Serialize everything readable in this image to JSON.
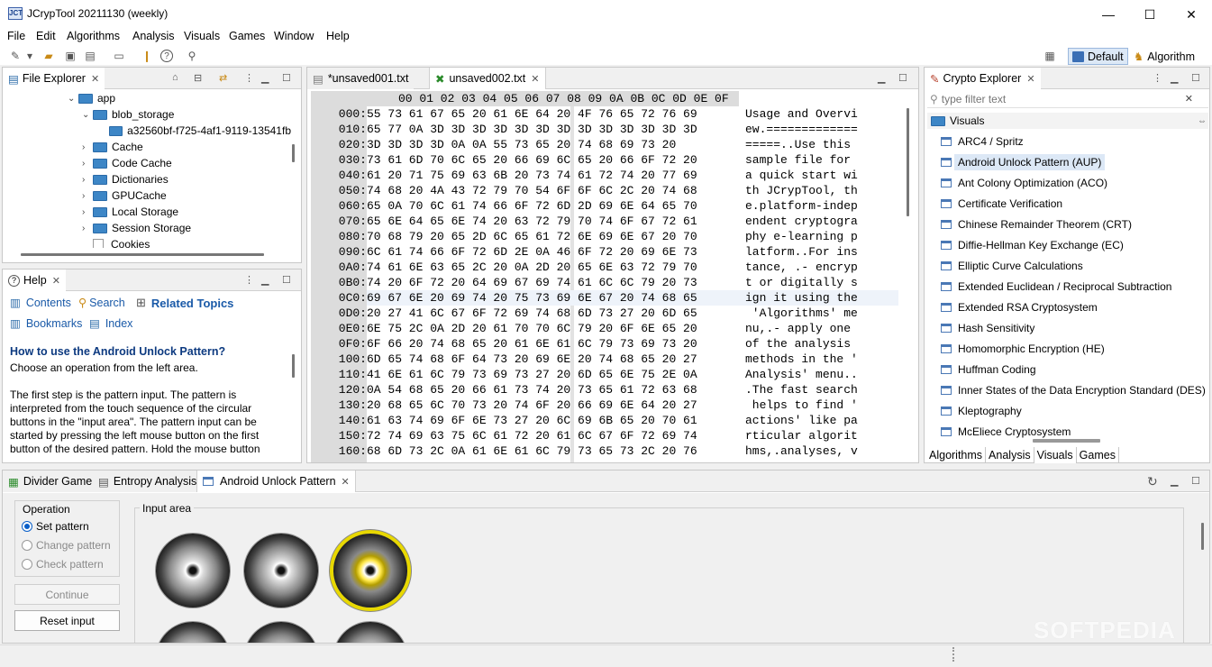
{
  "window": {
    "title": "JCrypTool 20211130 (weekly)",
    "icon": "JCT",
    "minimize": "—",
    "maximize": "☐",
    "close": "✕"
  },
  "menu": [
    "File",
    "Edit",
    "Algorithms",
    "Analysis",
    "Visuals",
    "Games",
    "Window",
    "Help"
  ],
  "perspectives": {
    "default": "Default",
    "algorithm": "Algorithm"
  },
  "file_explorer": {
    "tab": "File Explorer",
    "tree": [
      {
        "label": "app",
        "expanded": true
      },
      {
        "label": "blob_storage",
        "expanded": true
      },
      {
        "label": "a32560bf-f725-4af1-9119-13541fb"
      },
      {
        "label": "Cache"
      },
      {
        "label": "Code Cache"
      },
      {
        "label": "Dictionaries"
      },
      {
        "label": "GPUCache"
      },
      {
        "label": "Local Storage"
      },
      {
        "label": "Session Storage"
      },
      {
        "label": "Cookies"
      }
    ]
  },
  "help": {
    "tab": "Help",
    "contents": "Contents",
    "search": "Search",
    "related": "Related Topics",
    "bookmarks": "Bookmarks",
    "index": "Index",
    "heading": "How to use the Android Unlock Pattern?",
    "intro": "Choose an operation from the left area.",
    "body1": "The first step is the pattern input. The pattern is",
    "body2": "interpreted from the touch sequence of the circular",
    "body3": "buttons in the \"input area\". The pattern input can be",
    "body4": "started by pressing the left mouse button on the first",
    "body5": "button of the desired pattern. Hold the mouse button"
  },
  "editor": {
    "tabs": [
      "*unsaved001.txt",
      "unsaved002.txt"
    ],
    "header": "00 01 02 03 04 05 06 07 08 09 0A 0B 0C 0D 0E 0F",
    "rows": [
      {
        "off": "000:",
        "hex": "55 73 61 67 65 20 61 6E 64 20 4F 76 65 72 76 69",
        "txt": "Usage and Overvi"
      },
      {
        "off": "010:",
        "hex": "65 77 0A 3D 3D 3D 3D 3D 3D 3D 3D 3D 3D 3D 3D 3D",
        "txt": "ew.============="
      },
      {
        "off": "020:",
        "hex": "3D 3D 3D 3D 0A 0A 55 73 65 20 74 68 69 73 20",
        "txt": "=====..Use this "
      },
      {
        "off": "030:",
        "hex": "73 61 6D 70 6C 65 20 66 69 6C 65 20 66 6F 72 20",
        "txt": "sample file for "
      },
      {
        "off": "040:",
        "hex": "61 20 71 75 69 63 6B 20 73 74 61 72 74 20 77 69",
        "txt": "a quick start wi"
      },
      {
        "off": "050:",
        "hex": "74 68 20 4A 43 72 79 70 54 6F 6F 6C 2C 20 74 68",
        "txt": "th JCrypTool, th"
      },
      {
        "off": "060:",
        "hex": "65 0A 70 6C 61 74 66 6F 72 6D 2D 69 6E 64 65 70",
        "txt": "e.platform-indep"
      },
      {
        "off": "070:",
        "hex": "65 6E 64 65 6E 74 20 63 72 79 70 74 6F 67 72 61",
        "txt": "endent cryptogra"
      },
      {
        "off": "080:",
        "hex": "70 68 79 20 65 2D 6C 65 61 72 6E 69 6E 67 20 70",
        "txt": "phy e-learning p"
      },
      {
        "off": "090:",
        "hex": "6C 61 74 66 6F 72 6D 2E 0A 46 6F 72 20 69 6E 73",
        "txt": "latform..For ins"
      },
      {
        "off": "0A0:",
        "hex": "74 61 6E 63 65 2C 20 0A 2D 20 65 6E 63 72 79 70",
        "txt": "tance, .- encryp"
      },
      {
        "off": "0B0:",
        "hex": "74 20 6F 72 20 64 69 67 69 74 61 6C 6C 79 20 73",
        "txt": "t or digitally s"
      },
      {
        "off": "0C0:",
        "hex": "69 67 6E 20 69 74 20 75 73 69 6E 67 20 74 68 65",
        "txt": "ign it using the"
      },
      {
        "off": "0D0:",
        "hex": "20 27 41 6C 67 6F 72 69 74 68 6D 73 27 20 6D 65",
        "txt": " 'Algorithms' me"
      },
      {
        "off": "0E0:",
        "hex": "6E 75 2C 0A 2D 20 61 70 70 6C 79 20 6F 6E 65 20",
        "txt": "nu,.- apply one "
      },
      {
        "off": "0F0:",
        "hex": "6F 66 20 74 68 65 20 61 6E 61 6C 79 73 69 73 20",
        "txt": "of the analysis "
      },
      {
        "off": "100:",
        "hex": "6D 65 74 68 6F 64 73 20 69 6E 20 74 68 65 20 27",
        "txt": "methods in the '"
      },
      {
        "off": "110:",
        "hex": "41 6E 61 6C 79 73 69 73 27 20 6D 65 6E 75 2E 0A",
        "txt": "Analysis' menu.."
      },
      {
        "off": "120:",
        "hex": "0A 54 68 65 20 66 61 73 74 20 73 65 61 72 63 68",
        "txt": ".The fast search"
      },
      {
        "off": "130:",
        "hex": "20 68 65 6C 70 73 20 74 6F 20 66 69 6E 64 20 27",
        "txt": " helps to find '"
      },
      {
        "off": "140:",
        "hex": "61 63 74 69 6F 6E 73 27 20 6C 69 6B 65 20 70 61",
        "txt": "actions' like pa"
      },
      {
        "off": "150:",
        "hex": "72 74 69 63 75 6C 61 72 20 61 6C 67 6F 72 69 74",
        "txt": "rticular algorit"
      },
      {
        "off": "160:",
        "hex": "68 6D 73 2C 0A 61 6E 61 6C 79 73 65 73 2C 20 76",
        "txt": "hms,.analyses, v"
      }
    ]
  },
  "crypto_explorer": {
    "tab": "Crypto Explorer",
    "filter_placeholder": "type filter text",
    "category": "Visuals",
    "items": [
      "ARC4 / Spritz",
      "Android Unlock Pattern (AUP)",
      "Ant Colony Optimization (ACO)",
      "Certificate Verification",
      "Chinese Remainder Theorem (CRT)",
      "Diffie-Hellman Key Exchange (EC)",
      "Elliptic Curve Calculations",
      "Extended Euclidean / Reciprocal Subtraction",
      "Extended RSA Cryptosystem",
      "Hash Sensitivity",
      "Homomorphic Encryption (HE)",
      "Huffman Coding",
      "Inner States of the Data Encryption Standard (DES)",
      "Kleptography",
      "McEliece Cryptosystem"
    ],
    "selected_index": 1,
    "bottom_tabs": [
      "Algorithms",
      "Analysis",
      "Visuals",
      "Games"
    ],
    "active_bottom_tab": "Visuals"
  },
  "bottom": {
    "tabs": [
      "Divider Game",
      "Entropy Analysis",
      "Android Unlock Pattern"
    ],
    "operation_label": "Operation",
    "ops": [
      "Set pattern",
      "Change pattern",
      "Check pattern"
    ],
    "continue": "Continue",
    "reset": "Reset input",
    "input_area": "Input area"
  },
  "watermark": "SOFTPEDIA"
}
